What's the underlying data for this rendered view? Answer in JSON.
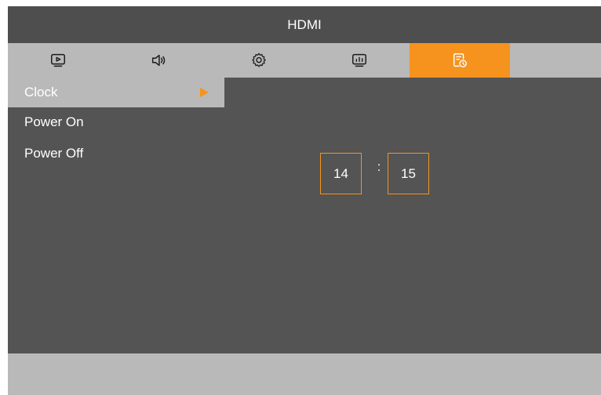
{
  "header": {
    "title": "HDMI"
  },
  "tabs": [
    {
      "icon": "play-screen-icon",
      "active": false
    },
    {
      "icon": "speaker-icon",
      "active": false
    },
    {
      "icon": "gear-icon",
      "active": false
    },
    {
      "icon": "monitor-chart-icon",
      "active": false
    },
    {
      "icon": "schedule-clock-icon",
      "active": true
    }
  ],
  "menu": {
    "items": [
      {
        "label": "Clock",
        "selected": true
      },
      {
        "label": "Power On",
        "selected": false
      },
      {
        "label": "Power Off",
        "selected": false
      }
    ]
  },
  "clock": {
    "hours": "14",
    "separator": ":",
    "minutes": "15"
  },
  "colors": {
    "accent": "#f6931e",
    "panel": "#545454",
    "bar": "#b9b9b9",
    "title_bar": "#4e4e4e",
    "text": "#ffffff"
  }
}
